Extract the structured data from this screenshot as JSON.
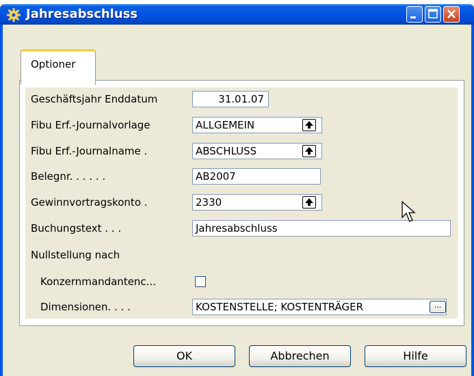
{
  "window": {
    "title": "Jahresabschluss"
  },
  "tabs": [
    {
      "label": "Optioner"
    }
  ],
  "form": {
    "fields": [
      {
        "label": "Geschäftsjahr Enddatum",
        "value": "31.01.07"
      },
      {
        "label": "Fibu Erf.-Journalvorlage",
        "value": "ALLGEMEIN"
      },
      {
        "label": "Fibu Erf.-Journalname .",
        "value": "ABSCHLUSS"
      },
      {
        "label": "Belegnr. . . . . .",
        "value": "AB2007"
      },
      {
        "label": "Gewinnvortragskonto .",
        "value": "2330"
      },
      {
        "label": "Buchungstext . . .",
        "value": "Jahresabschluss"
      }
    ],
    "section_label": "Nullstellung nach",
    "konzern": {
      "label": "Konzernmandantenc...",
      "checked": false
    },
    "dimensions": {
      "label": "Dimensionen. . . .",
      "value": "KOSTENSTELLE; KOSTENTRÄGER",
      "button": "..."
    }
  },
  "buttons": {
    "ok": "OK",
    "cancel": "Abbrechen",
    "help": "Hilfe"
  },
  "colors": {
    "titlebar": "#0054e3",
    "dialog_bg": "#ece9d8",
    "tab_accent": "#ffc83c"
  }
}
